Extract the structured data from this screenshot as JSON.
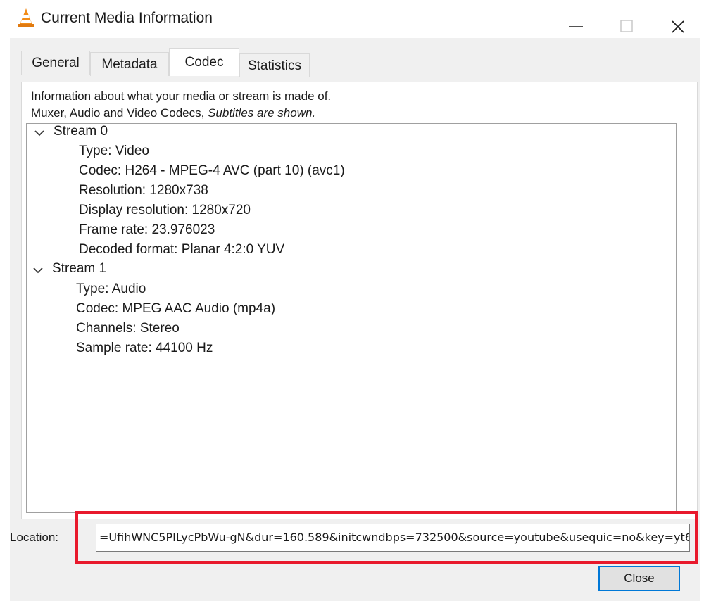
{
  "window": {
    "title": "Current Media Information",
    "accent_color": "#0078d7",
    "highlight_color": "#e8192c"
  },
  "tabs": [
    {
      "label": "General"
    },
    {
      "label": "Metadata"
    },
    {
      "label": "Codec",
      "active": true
    },
    {
      "label": "Statistics"
    }
  ],
  "codec": {
    "description_line1": "Information about what your media or stream is made of.",
    "description_line2_plain": "Muxer, Audio and Video Codecs, ",
    "description_line2_italic": "Subtitles are shown.",
    "streams": [
      {
        "name": "Stream 0",
        "props": [
          "Type: Video",
          "Codec: H264 - MPEG-4 AVC (part 10) (avc1)",
          "Resolution: 1280x738",
          "Display resolution: 1280x720",
          "Frame rate: 23.976023",
          "Decoded format: Planar 4:2:0 YUV"
        ]
      },
      {
        "name": "Stream 1",
        "props": [
          "Type: Audio",
          "Codec: MPEG AAC Audio (mp4a)",
          "Channels: Stereo",
          "Sample rate: 44100 Hz"
        ]
      }
    ]
  },
  "location": {
    "label": "Location:",
    "value": "=UfihWNC5PILycPbWu-gN&dur=160.589&initcwndbps=732500&source=youtube&usequic=no&key=yt6"
  },
  "buttons": {
    "close": "Close"
  },
  "icons": {
    "app": "vlc-cone-icon",
    "minimize": "minimize-icon",
    "maximize": "maximize-icon",
    "close": "close-icon",
    "expand": "chevron-down-icon"
  }
}
